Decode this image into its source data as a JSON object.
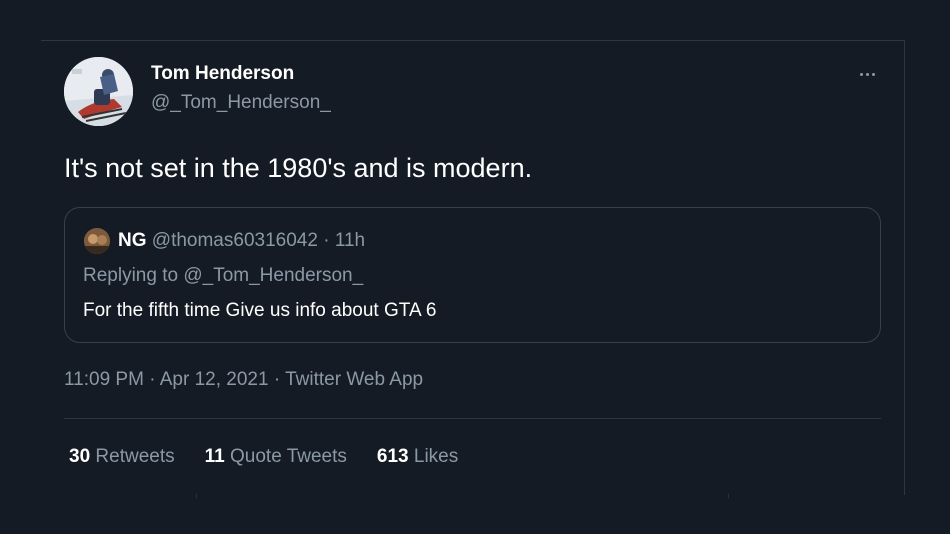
{
  "author": {
    "name": "Tom Henderson",
    "handle": "@_Tom_Henderson_"
  },
  "tweet": {
    "text": "It's not set in the 1980's and is modern.",
    "timestamp": "11:09 PM · Apr 12, 2021 · Twitter Web App"
  },
  "quoted": {
    "name": "NG",
    "handle": "@thomas60316042",
    "separator": " · ",
    "age": "11h",
    "replying_to": "Replying to @_Tom_Henderson_",
    "text": "For the fifth time Give us info about GTA 6"
  },
  "stats": [
    {
      "count": "30",
      "label": "Retweets"
    },
    {
      "count": "11",
      "label": "Quote Tweets"
    },
    {
      "count": "613",
      "label": "Likes"
    }
  ],
  "icons": {
    "more": "more-horizontal-icon"
  },
  "colors": {
    "background": "#151b24",
    "primary_text": "#ffffff",
    "secondary_text": "#8b98a5",
    "border": "#2f3640"
  }
}
